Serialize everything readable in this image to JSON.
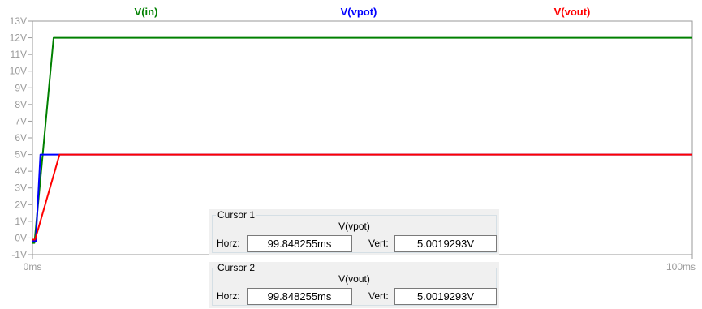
{
  "chart_data": {
    "type": "line",
    "x_unit": "ms",
    "xlim": [
      0,
      100
    ],
    "ylim": [
      -1,
      13
    ],
    "x_ticks": [
      {
        "value": 0,
        "label": "0ms"
      },
      {
        "value": 100,
        "label": "100ms"
      }
    ],
    "y_ticks": [
      {
        "value": 13,
        "label": "13V"
      },
      {
        "value": 12,
        "label": "12V"
      },
      {
        "value": 11,
        "label": "11V"
      },
      {
        "value": 10,
        "label": "10V"
      },
      {
        "value": 9,
        "label": "9V"
      },
      {
        "value": 8,
        "label": "8V"
      },
      {
        "value": 7,
        "label": "7V"
      },
      {
        "value": 6,
        "label": "6V"
      },
      {
        "value": 5,
        "label": "5V"
      },
      {
        "value": 4,
        "label": "4V"
      },
      {
        "value": 3,
        "label": "3V"
      },
      {
        "value": 2,
        "label": "2V"
      },
      {
        "value": 1,
        "label": "1V"
      },
      {
        "value": 0,
        "label": "0V"
      },
      {
        "value": -1,
        "label": "-1V"
      }
    ],
    "series": [
      {
        "name": "V(in)",
        "color": "#008000",
        "x": [
          0,
          0.3,
          3.2,
          100
        ],
        "y": [
          -0.3,
          -0.3,
          12,
          12
        ]
      },
      {
        "name": "V(vpot)",
        "color": "#0000ff",
        "x": [
          0,
          0.5,
          1.2,
          100
        ],
        "y": [
          -0.2,
          -0.2,
          5,
          5
        ]
      },
      {
        "name": "V(vout)",
        "color": "#ff0000",
        "x": [
          0,
          0.4,
          4.1,
          100
        ],
        "y": [
          -0.1,
          -0.1,
          5,
          5
        ]
      }
    ]
  },
  "cursors": [
    {
      "title": "Cursor 1",
      "trace": "V(vpot)",
      "horz_label": "Horz:",
      "horz_value": "99.848255ms",
      "vert_label": "Vert:",
      "vert_value": "5.0019293V"
    },
    {
      "title": "Cursor 2",
      "trace": "V(vout)",
      "horz_label": "Horz:",
      "horz_value": "99.848255ms",
      "vert_label": "Vert:",
      "vert_value": "5.0019293V"
    }
  ]
}
